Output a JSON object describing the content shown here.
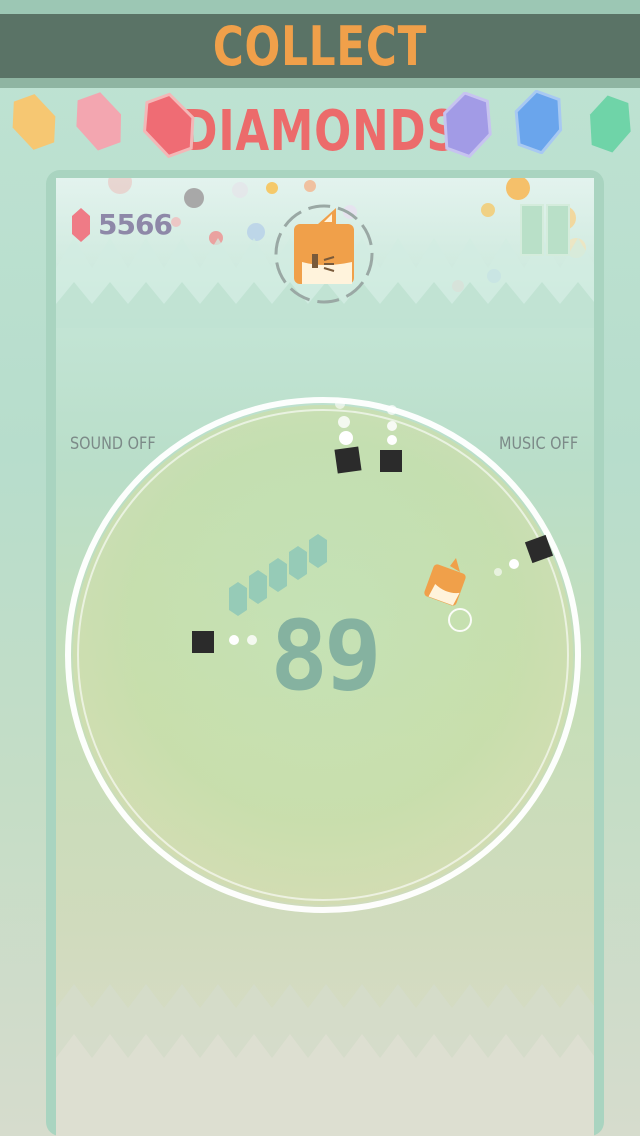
{
  "banner": {
    "line1": "COLLECT",
    "line2": "DIAMONDS",
    "line1_color": "#f0a04a",
    "line2_color": "#ec6b6b",
    "gem_colors": [
      "#f6c772",
      "#f3a6b0",
      "#ef6c74",
      "#a29be6",
      "#6aa5ec",
      "#6fd4a8"
    ]
  },
  "hud": {
    "diamond_count": "5566",
    "diamond_icon": "pink-gem-icon",
    "pause_icon": "pause-icon",
    "character": "orange-fox-cube-avatar"
  },
  "settings": {
    "sound_label": "SOUND OFF",
    "music_label": "MUSIC OFF"
  },
  "game": {
    "counter": "89",
    "player": "orange-fox-cube",
    "obstacle_color": "#2b2b2b",
    "ring_color": "#ffffff"
  }
}
